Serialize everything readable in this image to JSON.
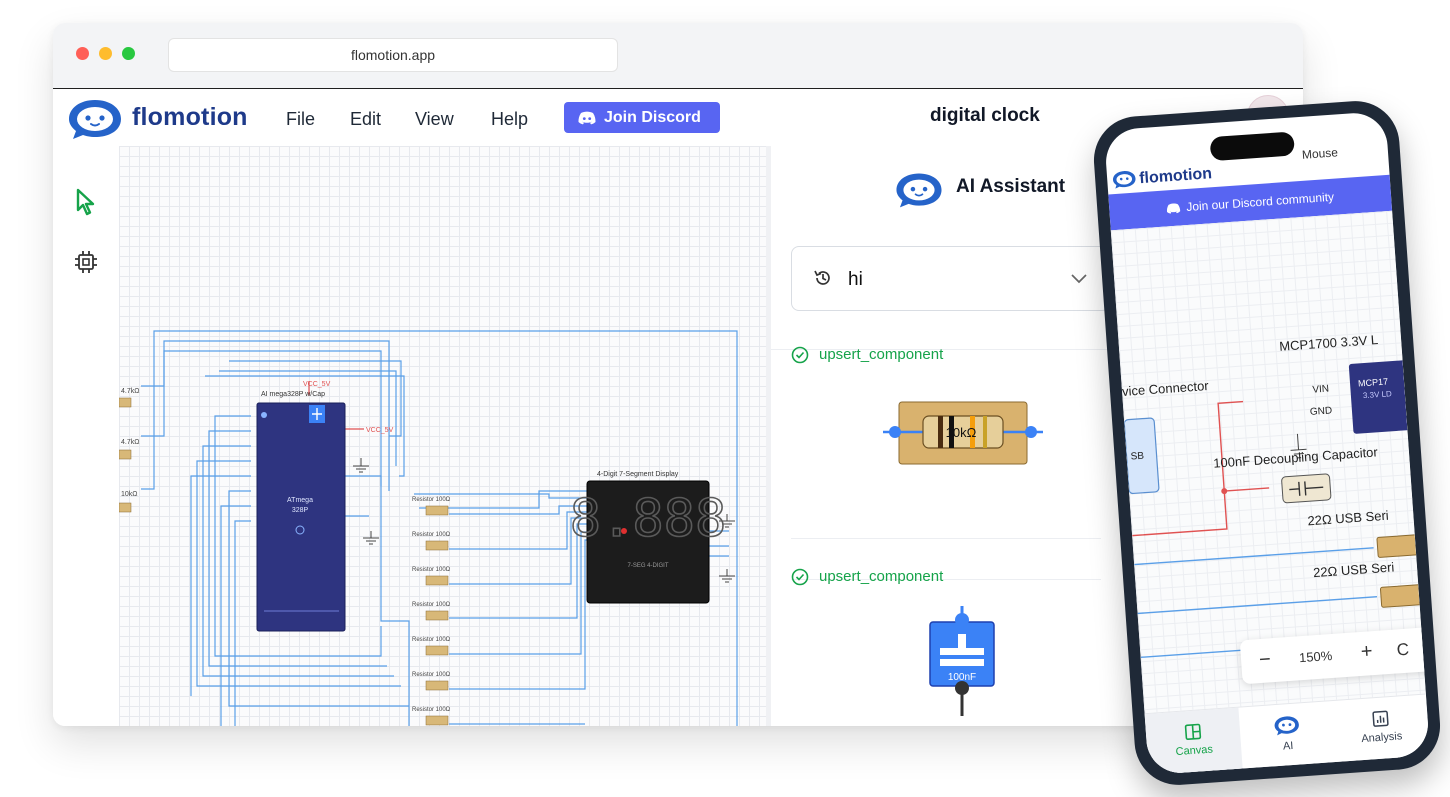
{
  "browser": {
    "url": "flomotion.app",
    "traffic_lights": [
      "#ff5f57",
      "#febc2e",
      "#28c840"
    ]
  },
  "app": {
    "brand": "flomotion",
    "menu": [
      "File",
      "Edit",
      "View",
      "Help"
    ],
    "discord_label": "Join Discord",
    "project_title": "digital clock",
    "colors": {
      "brand": "#1e3a8a",
      "logo": "#2563c9",
      "discord": "#5865f2",
      "success": "#16a34a",
      "wire": "#5a9fe8",
      "power": "#e05252"
    }
  },
  "toolbar": {
    "tools": [
      "select-pointer",
      "chip-component"
    ]
  },
  "schematic": {
    "left_labels": [
      "4.7kΩ",
      "4.7kΩ",
      "10kΩ"
    ],
    "mcu_header": "AI mega328P w/Cap",
    "mcu_name": "ATmega",
    "mcu_model": "328P",
    "vcc_labels": [
      "VCC_5V",
      "VCC_5V"
    ],
    "resistor_label": "Resistor 100Ω",
    "resistor_count": 8,
    "display_title": "4-Digit 7-Segment Display",
    "display_digits": "8.888",
    "display_part": "7-SEG 4-DIGIT"
  },
  "ai_panel": {
    "title": "AI Assistant",
    "conversation": "hi",
    "messages": [
      {
        "tool": "upsert_component",
        "preview": "resistor",
        "value": "10kΩ"
      },
      {
        "tool": "upsert_component",
        "preview": "capacitor",
        "value": "100nF"
      }
    ]
  },
  "phone": {
    "brand": "flomotion",
    "mouse_label": "Mouse",
    "discord_banner": "Join our Discord community",
    "labels": {
      "regulator": "MCP1700 3.3V L",
      "regulator_chip": "MCP17",
      "regulator_sub": "3.3V LD",
      "vin": "VIN",
      "gnd": "GND",
      "connector": "vice Connector",
      "usb_chip": "SB",
      "capacitor": "100nF Decoupling Capacitor",
      "usb_series_1": "22Ω USB Seri",
      "usb_series_2": "22Ω USB Seri"
    },
    "zoom": "150%",
    "zoom_minus": "−",
    "zoom_plus": "+",
    "zoom_reset": "C",
    "tabs": [
      "Canvas",
      "AI",
      "Analysis"
    ],
    "active_tab": "Canvas"
  }
}
